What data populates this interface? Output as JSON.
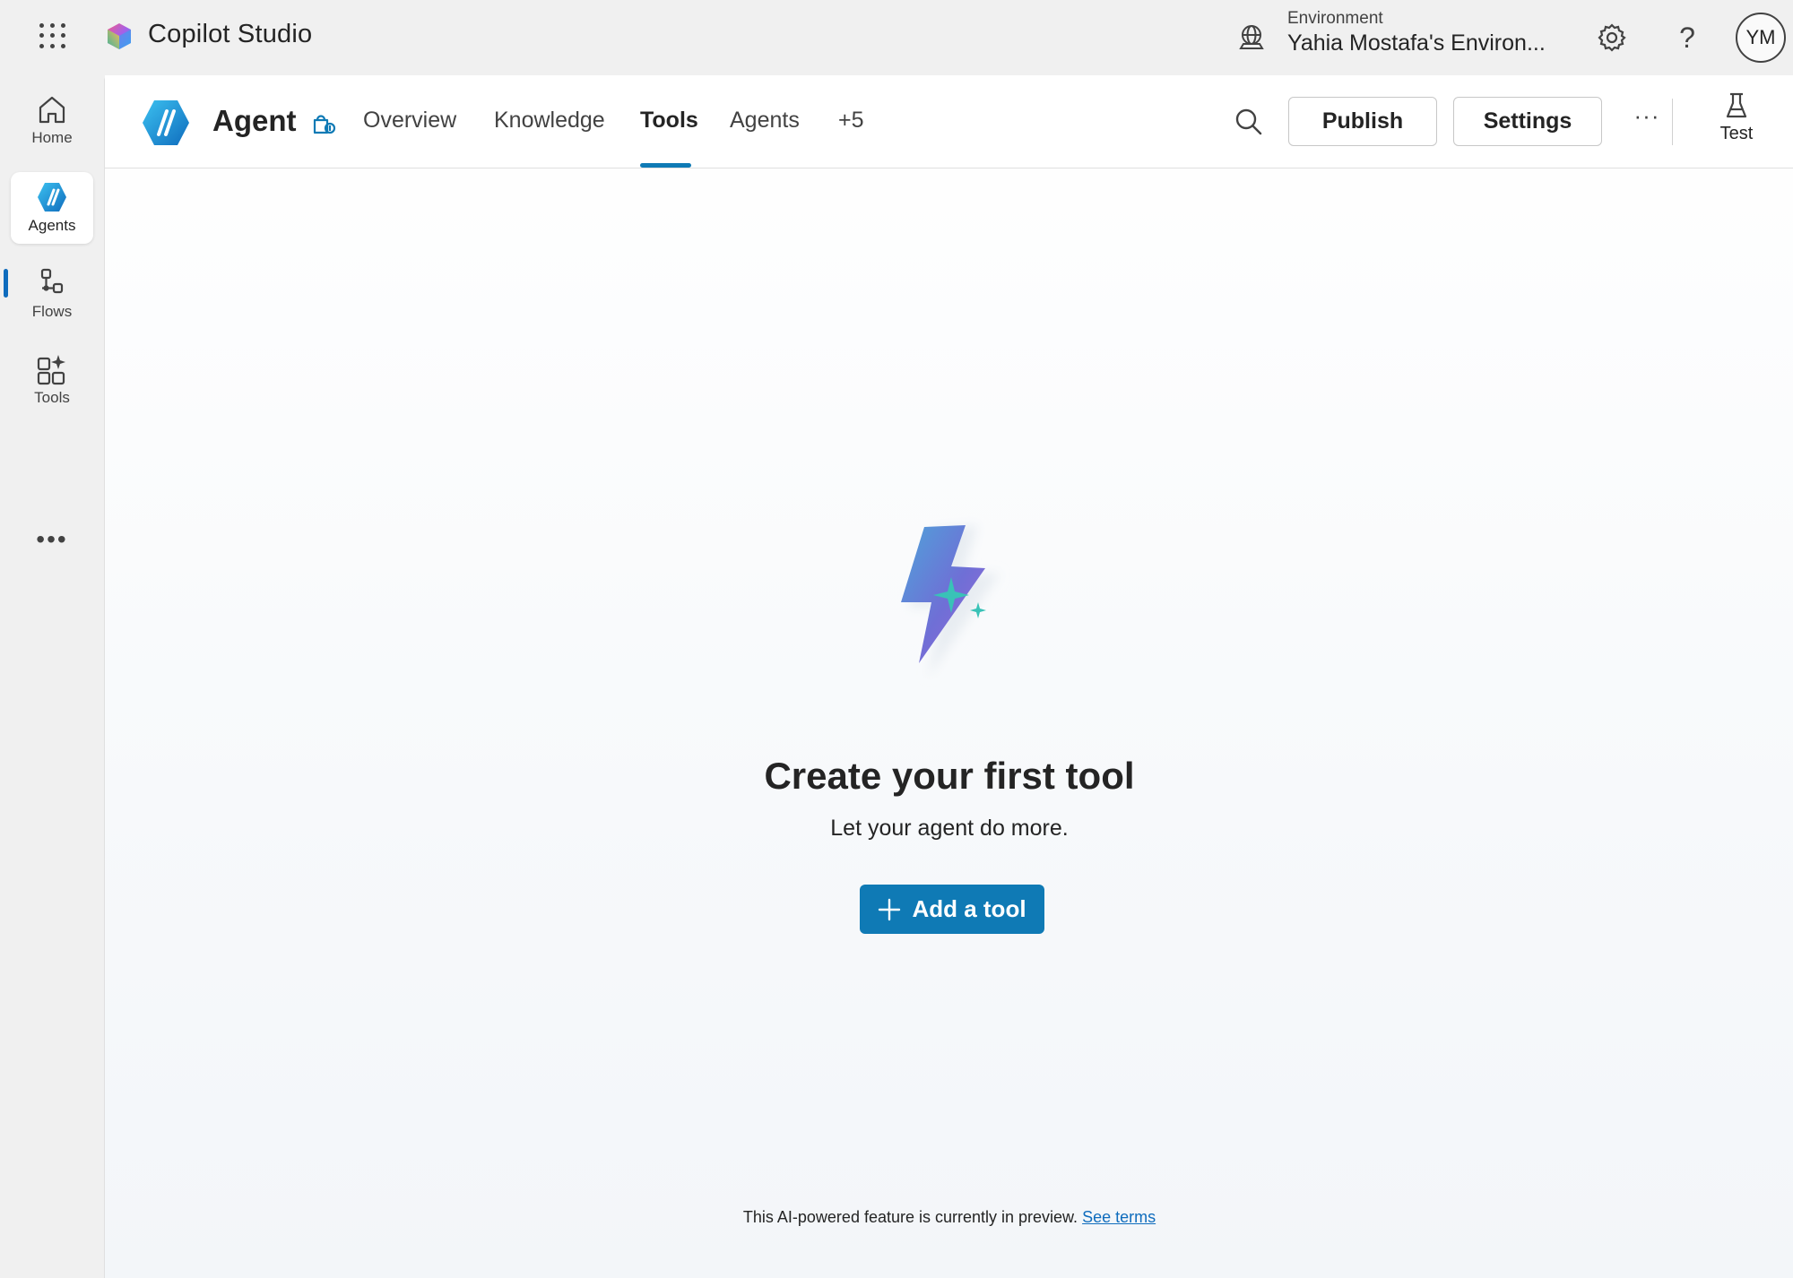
{
  "app": {
    "title": "Copilot Studio",
    "environment_label": "Environment",
    "environment_name": "Yahia Mostafa's Environ...",
    "avatar_initials": "YM",
    "help_glyph": "?"
  },
  "rail": {
    "items": [
      {
        "label": "Home",
        "icon": "home-icon"
      },
      {
        "label": "Agents",
        "icon": "agents-icon",
        "active": true
      },
      {
        "label": "Flows",
        "icon": "flows-icon"
      },
      {
        "label": "Tools",
        "icon": "tools-icon"
      }
    ],
    "more_glyph": "•••"
  },
  "header": {
    "agent_name": "Agent",
    "tabs": [
      {
        "label": "Overview"
      },
      {
        "label": "Knowledge"
      },
      {
        "label": "Tools",
        "active": true
      },
      {
        "label": "Agents"
      },
      {
        "label": "+5"
      }
    ],
    "publish_label": "Publish",
    "settings_label": "Settings",
    "more_glyph": "···",
    "test_label": "Test"
  },
  "empty_state": {
    "title": "Create your first tool",
    "subtitle": "Let your agent do more.",
    "add_button_label": "Add a tool"
  },
  "footer": {
    "note": "This AI-powered feature is currently in preview.",
    "link_text": "See terms"
  },
  "colors": {
    "accent": "#0f7ab5",
    "rail_indicator": "#0f6cbd",
    "link": "#0f6cbd"
  }
}
